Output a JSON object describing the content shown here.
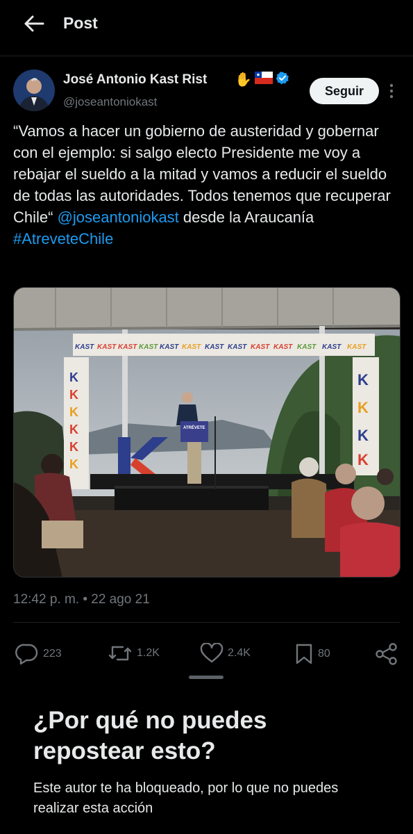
{
  "header": {
    "title": "Post"
  },
  "author": {
    "name": "José Antonio Kast Rist",
    "emojis": [
      "✋",
      "🇨🇱"
    ],
    "verified": true,
    "handle": "@joseantoniokast"
  },
  "follow_label": "Seguir",
  "tweet": {
    "text_before": "“Vamos a hacer un gobierno de austeridad y gobernar con el ejemplo: si salgo electo Presidente me voy a rebajar el sueldo a la mitad y vamos a reducir el sueldo de todas las autoridades. Todos tenemos que recuperar Chile“ ",
    "mention": "@joseantoniokast",
    "text_after": " desde la Araucanía ",
    "hashtag": "#AtreveteChile"
  },
  "media": {
    "banner_text": "KAST",
    "podium_text": "ATRÉVETE"
  },
  "timestamp": "12:42 p. m. • 22 ago 21",
  "actions": {
    "replies": "223",
    "reposts": "1.2K",
    "likes": "2.4K",
    "bookmarks": "80"
  },
  "sheet": {
    "title": "¿Por qué no puedes repostear esto?",
    "body": "Este autor te ha bloqueado, por lo que no puedes realizar esta acción"
  },
  "colors": {
    "background": "#000000",
    "link": "#1d9bf0",
    "muted": "#71767b",
    "verified": "#1d9bf0"
  }
}
